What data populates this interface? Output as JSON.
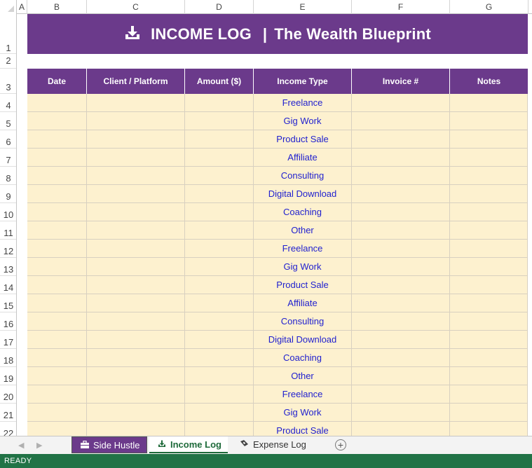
{
  "columns": [
    "A",
    "B",
    "C",
    "D",
    "E",
    "F",
    "G"
  ],
  "rows": [
    "1",
    "2",
    "3",
    "4",
    "5",
    "6",
    "7",
    "8",
    "9",
    "10",
    "11",
    "12",
    "13",
    "14",
    "15",
    "16",
    "17",
    "18",
    "19",
    "20",
    "21",
    "22"
  ],
  "title": {
    "text": "INCOME LOG",
    "separator": "|",
    "subtitle": "The Wealth Blueprint",
    "icon": "download-icon"
  },
  "table": {
    "headers": [
      "Date",
      "Client / Platform",
      "Amount ($)",
      "Income Type",
      "Invoice #",
      "Notes"
    ],
    "income_types": [
      "Freelance",
      "Gig Work",
      "Product Sale",
      "Affiliate",
      "Consulting",
      "Digital Download",
      "Coaching",
      "Other",
      "Freelance",
      "Gig Work",
      "Product Sale",
      "Affiliate",
      "Consulting",
      "Digital Download",
      "Coaching",
      "Other",
      "Freelance",
      "Gig Work",
      "Product Sale"
    ]
  },
  "tabs": [
    {
      "label": "Side Hustle",
      "icon": "briefcase-icon"
    },
    {
      "label": "Income Log",
      "icon": "download-icon",
      "active": true
    },
    {
      "label": "Expense Log",
      "icon": "money-flying-icon"
    }
  ],
  "status": "READY",
  "colors": {
    "header_purple": "#6b3a8b",
    "cell_fill": "#fdf1cf",
    "type_text": "#1f1fcf",
    "status_green": "#217346"
  }
}
